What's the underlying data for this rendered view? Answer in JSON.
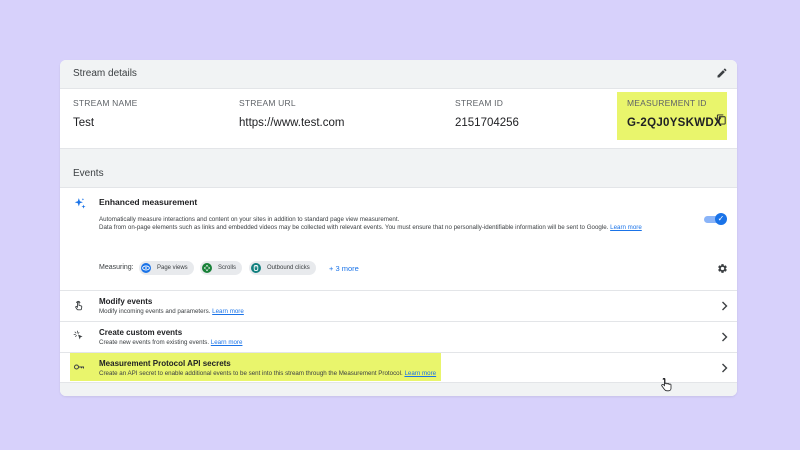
{
  "stream_details": {
    "header": "Stream details",
    "fields": [
      {
        "label": "STREAM NAME",
        "value": "Test"
      },
      {
        "label": "STREAM URL",
        "value": "https://www.test.com"
      },
      {
        "label": "STREAM ID",
        "value": "2151704256"
      },
      {
        "label": "MEASUREMENT ID",
        "value": "G-2QJ0YSKWDX"
      }
    ],
    "highlight_color": "#e9f56c"
  },
  "events": {
    "header": "Events",
    "enhanced": {
      "title": "Enhanced measurement",
      "description": "Automatically measure interactions and content on your sites in addition to standard page view measurement.",
      "description2": "Data from on-page elements such as links and embedded videos may be collected with relevant events. You must ensure that no personally-identifiable information will be sent to Google.",
      "learn_more": "Learn more",
      "toggle_on": true,
      "measuring_label": "Measuring:",
      "chips": [
        {
          "label": "Page views",
          "icon": "eye-icon",
          "color": "#1a73e8"
        },
        {
          "label": "Scrolls",
          "icon": "scroll-icon",
          "color": "#188038"
        },
        {
          "label": "Outbound clicks",
          "icon": "outbound-click-icon",
          "color": "#12807f"
        }
      ],
      "more": "+ 3 more"
    },
    "rows": [
      {
        "title": "Modify events",
        "subtitle": "Modify incoming events and parameters.",
        "link": "Learn more",
        "icon": "touch-icon"
      },
      {
        "title": "Create custom events",
        "subtitle": "Create new events from existing events.",
        "link": "Learn more",
        "icon": "custom-event-icon"
      },
      {
        "title": "Measurement Protocol API secrets",
        "subtitle": "Create an API secret to enable additional events to be sent into this stream through the Measurement Protocol.",
        "link": "Learn more",
        "icon": "key-icon",
        "highlighted": true
      }
    ]
  },
  "colors": {
    "accent": "#1a73e8",
    "background": "#d7d1fb"
  }
}
